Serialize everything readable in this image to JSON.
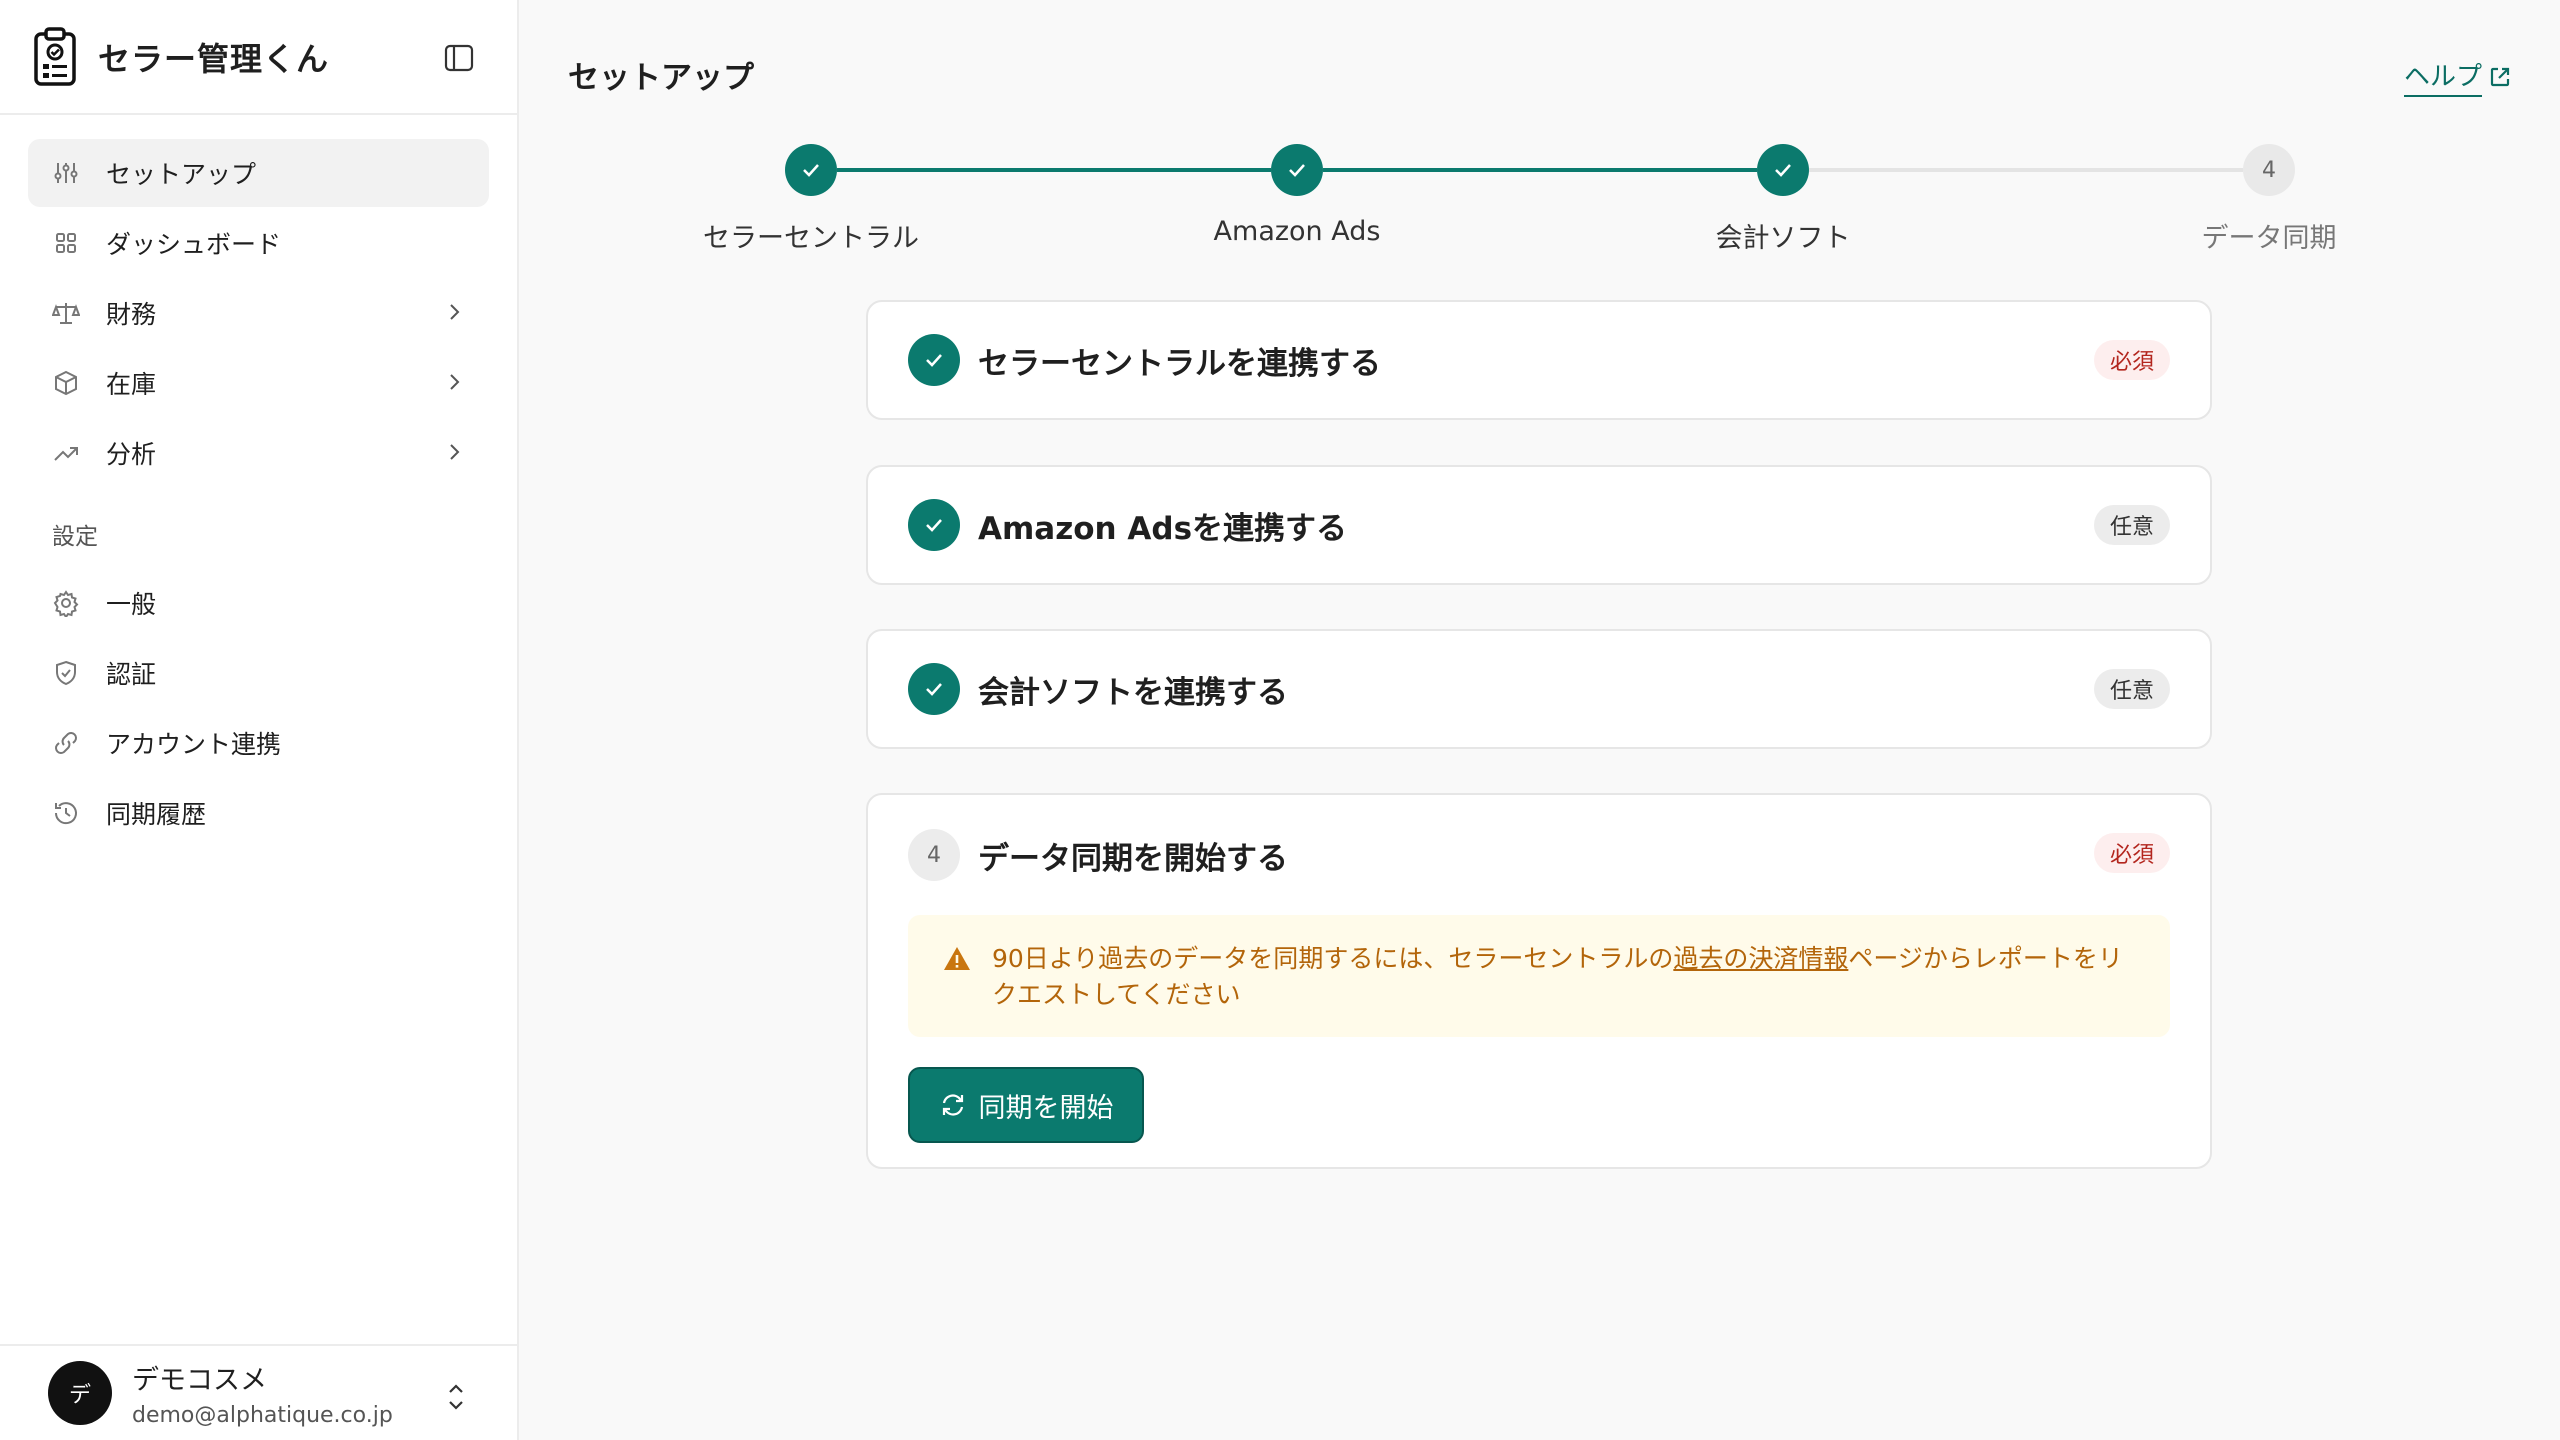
{
  "app": {
    "name": "セラー管理くん"
  },
  "colors": {
    "accent": "#0b7a6e",
    "required": "#b3261e",
    "warning": "#b3650a"
  },
  "sidebar": {
    "items": [
      {
        "label": "セットアップ",
        "icon": "sliders-icon",
        "active": true
      },
      {
        "label": "ダッシュボード",
        "icon": "grid-icon"
      },
      {
        "label": "財務",
        "icon": "scale-icon",
        "expandable": true
      },
      {
        "label": "在庫",
        "icon": "box-icon",
        "expandable": true
      },
      {
        "label": "分析",
        "icon": "trending-icon",
        "expandable": true
      }
    ],
    "settings_label": "設定",
    "settings_items": [
      {
        "label": "一般",
        "icon": "gear-icon"
      },
      {
        "label": "認証",
        "icon": "shield-icon"
      },
      {
        "label": "アカウント連携",
        "icon": "link-icon"
      },
      {
        "label": "同期履歴",
        "icon": "history-icon"
      }
    ]
  },
  "user": {
    "initial": "デ",
    "name": "デモコスメ",
    "email": "demo@alphatique.co.jp"
  },
  "header": {
    "title": "セットアップ",
    "help_label": "ヘルプ"
  },
  "stepper": {
    "steps": [
      {
        "label": "セラーセントラル",
        "status": "done"
      },
      {
        "label": "Amazon Ads",
        "status": "done"
      },
      {
        "label": "会計ソフト",
        "status": "done"
      },
      {
        "label": "データ同期",
        "status": "pending",
        "number": "4"
      }
    ]
  },
  "cards": [
    {
      "title": "セラーセントラルを連携する",
      "badge": "必須",
      "status": "done"
    },
    {
      "title": "Amazon Adsを連携する",
      "badge": "任意",
      "status": "done"
    },
    {
      "title": "会計ソフトを連携する",
      "badge": "任意",
      "status": "done"
    },
    {
      "title": "データ同期を開始する",
      "badge": "必須",
      "status": "pending",
      "number": "4"
    }
  ],
  "alert": {
    "text_before": "90日より過去のデータを同期するには、セラーセントラルの",
    "link_text": "過去の決済情報",
    "text_after": "ページからレポートをリクエストしてください"
  },
  "sync_button": {
    "label": "同期を開始"
  }
}
